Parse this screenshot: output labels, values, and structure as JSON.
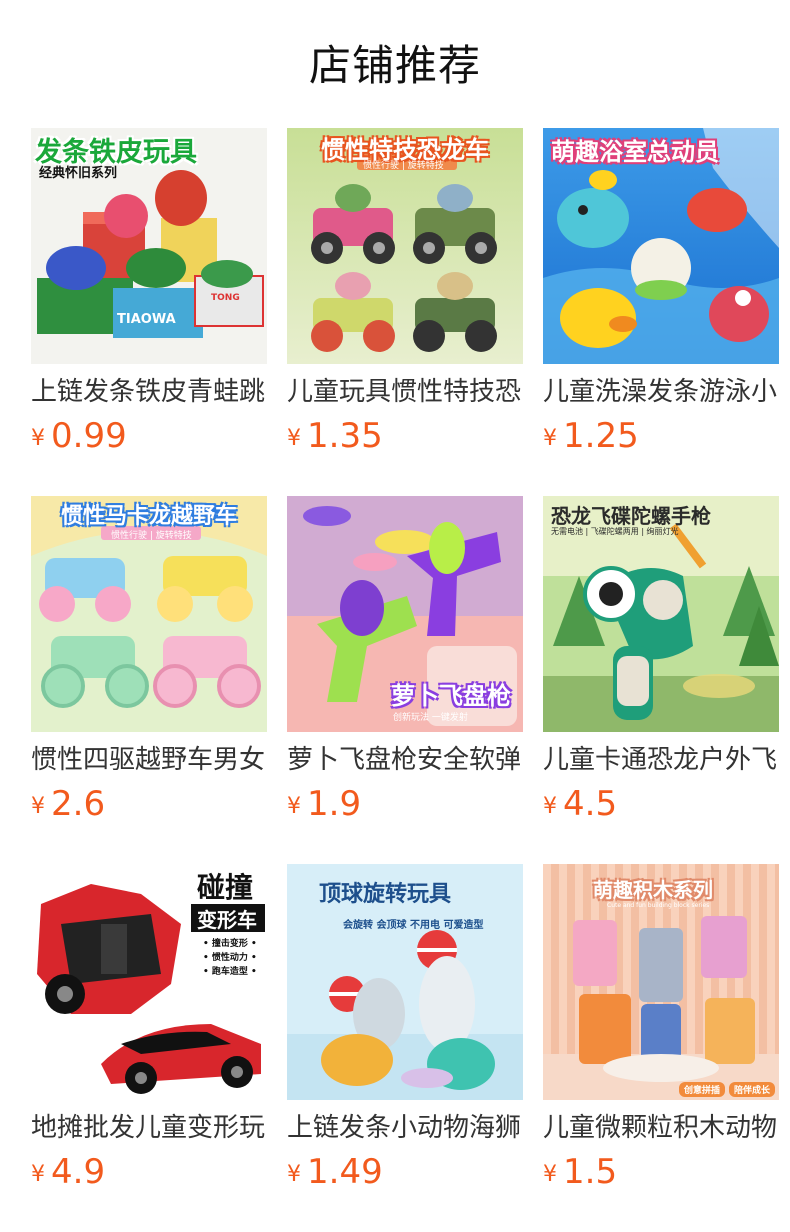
{
  "header": {
    "title": "店铺推荐"
  },
  "currency": "¥",
  "products": [
    {
      "name": "上链发条铁皮青蛙跳",
      "price": "0.99",
      "banner": "发条铁皮玩具",
      "banner_sub": "经典怀旧系列",
      "box_label_1": "TIAOWA",
      "box_label_2": "TONG",
      "colors": {
        "bg": "#f2f2ee",
        "banner": "#1aa83a",
        "accent": "#d93a2b"
      }
    },
    {
      "name": "儿童玩具惯性特技恐",
      "price": "1.35",
      "banner": "惯性特技恐龙车",
      "banner_sub": "惯性行驶 | 旋转特技",
      "colors": {
        "bg": "#b9d98a",
        "banner": "#e8541f",
        "accent": "#6aa84f"
      }
    },
    {
      "name": "儿童洗澡发条游泳小",
      "price": "1.25",
      "banner": "萌趣浴室总动员",
      "colors": {
        "bg": "#2f8fe0",
        "banner": "#e0407a",
        "accent": "#ffd21f"
      }
    },
    {
      "name": "惯性四驱越野车男女",
      "price": "2.6",
      "banner": "惯性马卡龙越野车",
      "banner_sub": "惯性行驶 | 旋转特技",
      "colors": {
        "bg": "#dff0c8",
        "banner": "#2f7de0",
        "accent": "#f7a8c8"
      }
    },
    {
      "name": "萝卜飞盘枪安全软弹",
      "price": "1.9",
      "banner": "萝卜飞盘枪",
      "banner_sub": "创新玩法 一键发射",
      "colors": {
        "bg": "#f4b7b3",
        "banner": "#ffffff",
        "accent": "#8a3ee0"
      }
    },
    {
      "name": "儿童卡通恐龙户外飞",
      "price": "4.5",
      "banner": "恐龙飞碟陀螺手枪",
      "banner_sub": "无需电池 | 飞碟陀螺两用 | 绚丽灯光",
      "colors": {
        "bg": "#9fce7a",
        "banner": "#2b2b2b",
        "accent": "#1f9e7a"
      }
    },
    {
      "name": "地摊批发儿童变形玩",
      "price": "4.9",
      "banner": "碰撞",
      "banner_sub": "变形车",
      "feature_1": "• 撞击变形 •",
      "feature_2": "• 惯性动力 •",
      "feature_3": "• 跑车造型 •",
      "colors": {
        "bg": "#ffffff",
        "banner": "#111111",
        "accent": "#d8262c"
      }
    },
    {
      "name": "上链发条小动物海狮",
      "price": "1.49",
      "banner": "顶球旋转玩具",
      "banner_sub": "会旋转 会顶球 不用电 可爱造型",
      "colors": {
        "bg": "#d7eef8",
        "banner": "#1d4f8c",
        "accent": "#e63b3b"
      }
    },
    {
      "name": "儿童微颗粒积木动物",
      "price": "1.5",
      "banner": "萌趣积木系列",
      "banner_sub": "Cute and fun building block series",
      "tag_1": "创意拼插",
      "tag_2": "陪伴成长",
      "colors": {
        "bg": "#f6c9b0",
        "banner": "#ffffff",
        "accent": "#f28b3c"
      }
    }
  ]
}
